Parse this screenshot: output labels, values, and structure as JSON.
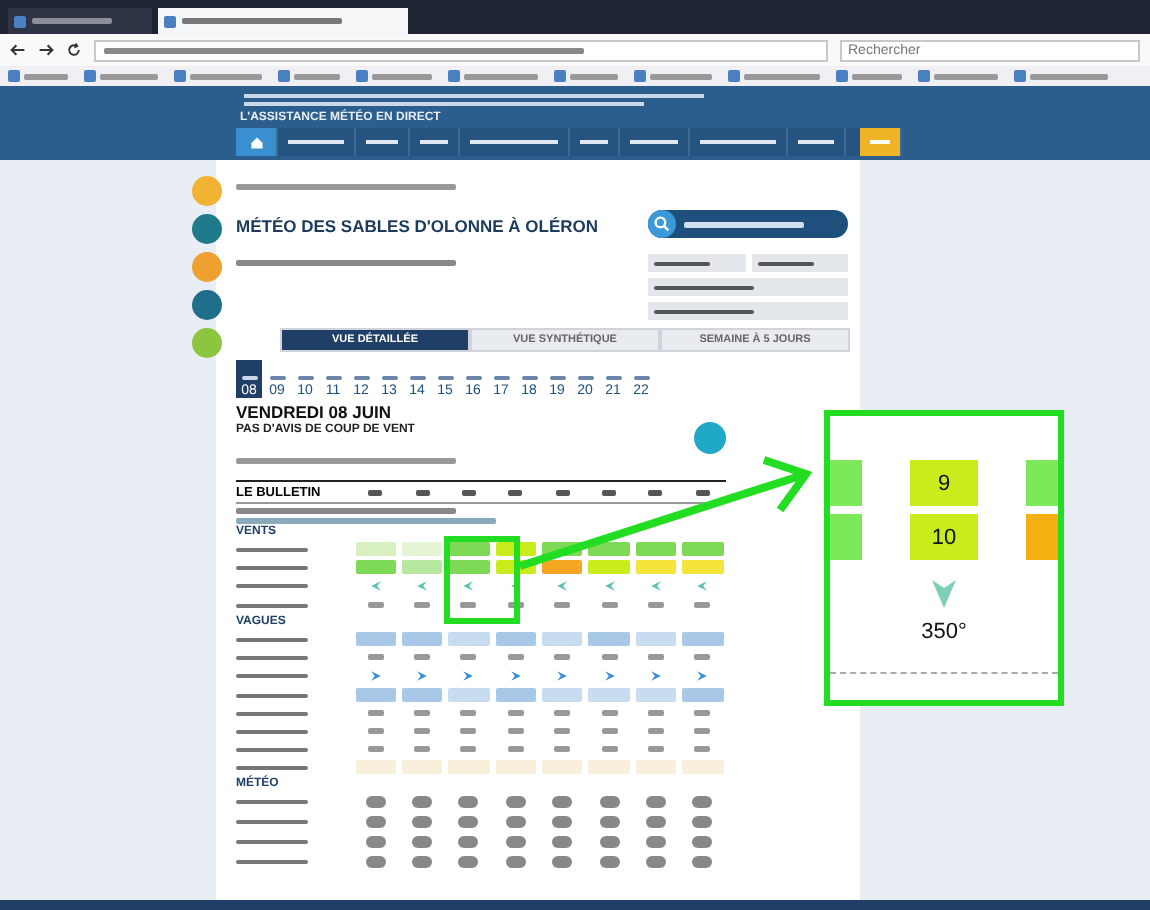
{
  "browser": {
    "search": {
      "placeholder": "Rechercher"
    }
  },
  "banner": {
    "title": "L'ASSISTANCE MÉTÉO EN DIRECT",
    "nav": [
      {
        "selected": false
      },
      {
        "selected": false
      },
      {
        "selected": false
      },
      {
        "selected": false
      },
      {
        "selected": false
      },
      {
        "selected": false
      },
      {
        "selected": false
      },
      {
        "selected": false
      },
      {
        "selected": false
      },
      {
        "selected": true
      }
    ]
  },
  "sidebar": [
    {
      "color": "#f2b233"
    },
    {
      "color": "#1f7a8c"
    },
    {
      "color": "#f0a030"
    },
    {
      "color": "#1f6f8b"
    },
    {
      "color": "#8cc63f"
    }
  ],
  "page": {
    "title": "MÉTÉO DES SABLES D'OLONNE À OLÉRON"
  },
  "view_tabs": [
    {
      "label": "VUE DÉTAILLÉE",
      "selected": true
    },
    {
      "label": "VUE SYNTHÉTIQUE",
      "selected": false
    },
    {
      "label": "SEMAINE À 5 JOURS",
      "selected": false
    }
  ],
  "days": [
    {
      "date": "08",
      "selected": true
    },
    {
      "date": "09",
      "selected": false
    },
    {
      "date": "10",
      "selected": false
    },
    {
      "date": "11",
      "selected": false
    },
    {
      "date": "12",
      "selected": false
    },
    {
      "date": "13",
      "selected": false
    },
    {
      "date": "14",
      "selected": false
    },
    {
      "date": "15",
      "selected": false
    },
    {
      "date": "16",
      "selected": false
    },
    {
      "date": "17",
      "selected": false
    },
    {
      "date": "18",
      "selected": false
    },
    {
      "date": "19",
      "selected": false
    },
    {
      "date": "20",
      "selected": false
    },
    {
      "date": "21",
      "selected": false
    },
    {
      "date": "22",
      "selected": false
    }
  ],
  "day": {
    "title": "VENDREDI 08 JUIN",
    "alert": "PAS D'AVIS DE COUP DE VENT"
  },
  "bulletin": {
    "title": "LE BULLETIN"
  },
  "sections": [
    {
      "title": "VENTS",
      "rows": [
        {
          "kind": "cells",
          "cells": [
            {
              "color": "#d8f0c0"
            },
            {
              "color": "#e6f5d6"
            },
            {
              "color": "#7ed957"
            },
            {
              "color": "#c8ec1c"
            },
            {
              "color": "#7ed957"
            },
            {
              "color": "#7ed957"
            },
            {
              "color": "#7ed957"
            },
            {
              "color": "#7ed957"
            }
          ]
        },
        {
          "kind": "cells",
          "cells": [
            {
              "color": "#7ed957"
            },
            {
              "color": "#b8e8a0"
            },
            {
              "color": "#7ed957"
            },
            {
              "color": "#c8ec1c"
            },
            {
              "color": "#f5a623"
            },
            {
              "color": "#c8ec1c"
            },
            {
              "color": "#f5e53a"
            },
            {
              "color": "#f5e53a"
            }
          ]
        },
        {
          "kind": "arrows"
        },
        {
          "kind": "text"
        }
      ]
    },
    {
      "title": "VAGUES",
      "rows": [
        {
          "kind": "cells",
          "cells": [
            {
              "color": "#a8c8e8"
            },
            {
              "color": "#a8c8e8"
            },
            {
              "color": "#c8dcf0"
            },
            {
              "color": "#a8c8e8"
            },
            {
              "color": "#c8dcf0"
            },
            {
              "color": "#a8c8e8"
            },
            {
              "color": "#c8dcf0"
            },
            {
              "color": "#a8c8e8"
            }
          ]
        },
        {
          "kind": "text"
        },
        {
          "kind": "arrows"
        },
        {
          "kind": "cells",
          "cells": [
            {
              "color": "#a8c8e8"
            },
            {
              "color": "#a8c8e8"
            },
            {
              "color": "#c8dcf0"
            },
            {
              "color": "#a8c8e8"
            },
            {
              "color": "#c8dcf0"
            },
            {
              "color": "#c8dcf0"
            },
            {
              "color": "#c8dcf0"
            },
            {
              "color": "#a8c8e8"
            }
          ]
        },
        {
          "kind": "text"
        },
        {
          "kind": "text"
        },
        {
          "kind": "text"
        },
        {
          "kind": "cells",
          "cells": [
            {
              "color": "#f7efd9"
            },
            {
              "color": "#f7efd9"
            },
            {
              "color": "#f7efd9"
            },
            {
              "color": "#f7efd9"
            },
            {
              "color": "#f7efd9"
            },
            {
              "color": "#f7efd9"
            },
            {
              "color": "#f7efd9"
            },
            {
              "color": "#f7efd9"
            }
          ]
        }
      ]
    },
    {
      "title": "MÉTÉO",
      "rows": [
        {
          "kind": "icons"
        },
        {
          "kind": "icons"
        },
        {
          "kind": "icons"
        },
        {
          "kind": "icons"
        }
      ]
    }
  ],
  "inset": {
    "rows": [
      {
        "cells": [
          {
            "color": "#7de85a"
          },
          {
            "color": "#c8ec1c",
            "value": "9"
          },
          {
            "color": "#7de85a"
          }
        ]
      },
      {
        "cells": [
          {
            "color": "#7de85a"
          },
          {
            "color": "#c8ec1c",
            "value": "10"
          },
          {
            "color": "#f5b00f"
          }
        ]
      }
    ],
    "direction": "350°"
  }
}
